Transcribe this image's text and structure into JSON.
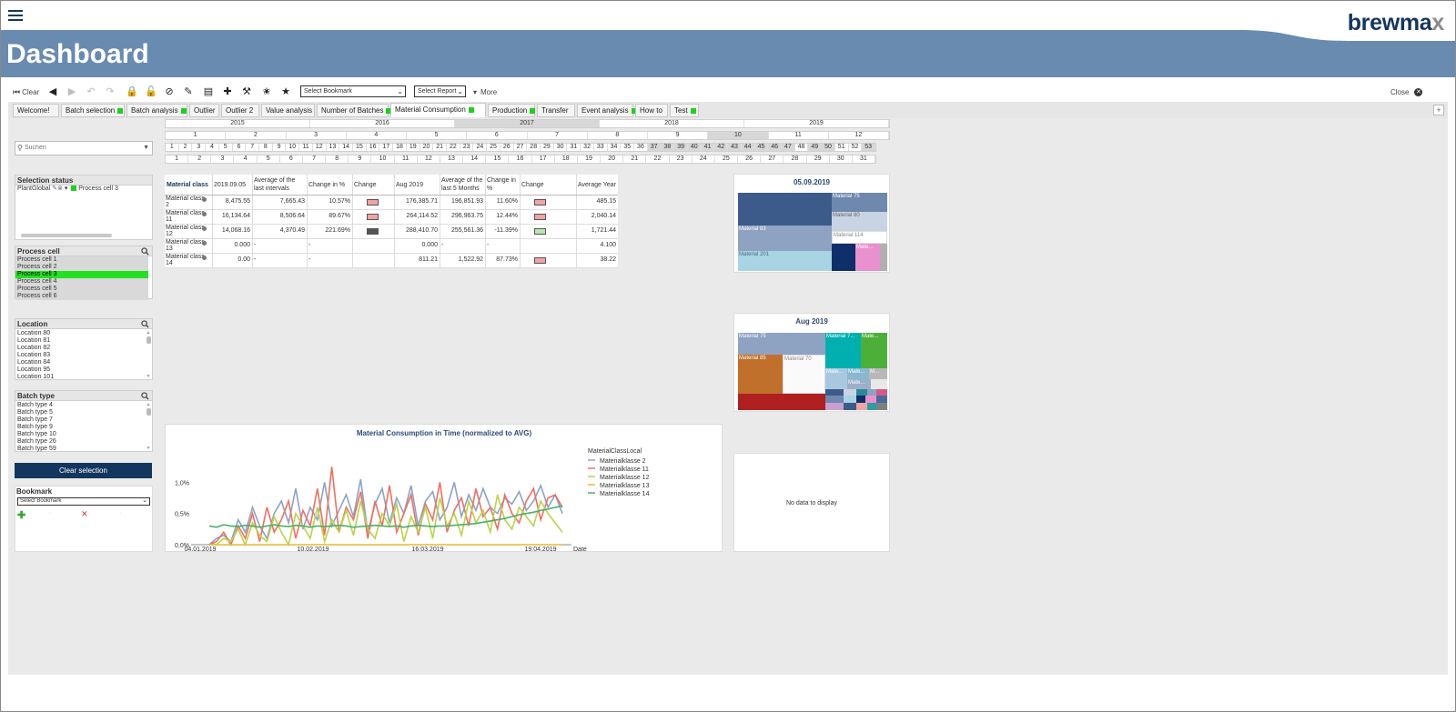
{
  "brand": {
    "name": "brewma",
    "x": "x"
  },
  "page_title": "Dashboard",
  "toolbar": {
    "clear": "Clear",
    "bookmark_select": "Select Bookmark",
    "report_select": "Select Report",
    "more": "More",
    "close": "Close"
  },
  "tabs": [
    {
      "label": "Welcome!",
      "dot": false
    },
    {
      "label": "Batch selection",
      "dot": true
    },
    {
      "label": "Batch analysis",
      "dot": true
    },
    {
      "label": "Outlier",
      "dot": false
    },
    {
      "label": "Outlier 2",
      "dot": false
    },
    {
      "label": "Value analysis",
      "dot": false
    },
    {
      "label": "Number of Batches",
      "dot": true
    },
    {
      "label": "Material Consumption",
      "dot": true
    },
    {
      "label": "Production",
      "dot": true
    },
    {
      "label": "Transfer",
      "dot": false
    },
    {
      "label": "Event analysis",
      "dot": true
    },
    {
      "label": "How to",
      "dot": false
    },
    {
      "label": "Test",
      "dot": true
    }
  ],
  "years": [
    "2015",
    "2016",
    "2017",
    "2018",
    "2019"
  ],
  "months": [
    "1",
    "2",
    "3",
    "4",
    "5",
    "6",
    "7",
    "8",
    "9",
    "10",
    "11",
    "12"
  ],
  "weeks": [
    "1",
    "2",
    "3",
    "4",
    "5",
    "6",
    "7",
    "8",
    "9",
    "10",
    "11",
    "12",
    "13",
    "14",
    "15",
    "16",
    "17",
    "18",
    "19",
    "20",
    "21",
    "22",
    "23",
    "24",
    "25",
    "26",
    "27",
    "28",
    "29",
    "30",
    "31",
    "32",
    "33",
    "34",
    "35",
    "36",
    "37",
    "38",
    "39",
    "40",
    "41",
    "42",
    "43",
    "44",
    "45",
    "46",
    "47",
    "48",
    "49",
    "50",
    "51",
    "52",
    "53"
  ],
  "days": [
    "1",
    "2",
    "3",
    "4",
    "5",
    "6",
    "7",
    "8",
    "9",
    "10",
    "11",
    "12",
    "13",
    "14",
    "15",
    "16",
    "17",
    "18",
    "19",
    "20",
    "21",
    "22",
    "23",
    "24",
    "25",
    "26",
    "27",
    "28",
    "29",
    "30",
    "31"
  ],
  "search": {
    "placeholder": "Suchen"
  },
  "selection_status": {
    "title": "Selection status",
    "field": "PlantGlobal",
    "value": "Process cell 3"
  },
  "process_cell": {
    "title": "Process cell",
    "items": [
      "Process cell 1",
      "Process cell 2",
      "Process cell 3",
      "Process cell 4",
      "Process cell 5",
      "Process cell 6"
    ],
    "selected": 2
  },
  "location": {
    "title": "Location",
    "items": [
      "Location 80",
      "Location 81",
      "Location 82",
      "Location 83",
      "Location 84",
      "Location 95",
      "Location 101"
    ]
  },
  "batch_type": {
    "title": "Batch type",
    "items": [
      "Batch type 4",
      "Batch type 5",
      "Batch type 7",
      "Batch type 9",
      "Batch type 10",
      "Batch type 26",
      "Batch type 59"
    ]
  },
  "clear_selection": "Clear selection",
  "bookmark": {
    "title": "Bookmark",
    "select": "Select Bookmark"
  },
  "table": {
    "headers": [
      "Material class",
      "2019.09.05",
      "Average of the last intervals",
      "Change in %",
      "Change",
      "Aug 2019",
      "Average of the last 5 Months",
      "Change in %",
      "Change",
      "Average Year"
    ],
    "rows": [
      {
        "label": "Material class 2",
        "v1": "8,475.55",
        "avg1": "7,665.43",
        "pct1": "10.57%",
        "c1": "#f2a3a3",
        "v2": "176,385.71",
        "avg2": "196,851.93",
        "pct2": "11.60%",
        "c2": "#f2a3a3",
        "year": "485.15"
      },
      {
        "label": "Material class 11",
        "v1": "16,134.64",
        "avg1": "8,506.64",
        "pct1": "89.67%",
        "c1": "#f2a3a3",
        "v2": "264,114.52",
        "avg2": "296,963.75",
        "pct2": "12.44%",
        "c2": "#f2a3a3",
        "year": "2,040.14"
      },
      {
        "label": "Material class 12",
        "v1": "14,068.16",
        "avg1": "4,370.49",
        "pct1": "221.69%",
        "c1": "#555555",
        "v2": "288,410.70",
        "avg2": "255,561.36",
        "pct2": "-11.39%",
        "c2": "#b8e6b0",
        "year": "1,721.44"
      },
      {
        "label": "Material class 13",
        "v1": "0.000",
        "avg1": "-",
        "pct1": "-",
        "c1": "",
        "v2": "0.000",
        "avg2": "-",
        "pct2": "-",
        "c2": "",
        "year": "4.100"
      },
      {
        "label": "Material class 14",
        "v1": "0.00",
        "avg1": "-",
        "pct1": "-",
        "c1": "",
        "v2": "811.21",
        "avg2": "1,522.92",
        "pct2": "87.73%",
        "c2": "#f2a3a3",
        "year": "38.22"
      }
    ]
  },
  "treemap1": {
    "title": "05.09.2019",
    "labels": [
      "Material 75",
      "Material 80",
      "Material 83",
      "Material 114",
      "Material 201",
      "Mate..."
    ]
  },
  "treemap2": {
    "title": "Aug 2019",
    "labels": [
      "Material 75",
      "Material 7...",
      "Mate...",
      "Material 85",
      "Material 70",
      "Mate...",
      "Mate...",
      "M...",
      "Mate..."
    ]
  },
  "no_data": "No data to display",
  "chart_data": {
    "type": "line",
    "title": "Material Consumption in Time (normalized to AVG)",
    "xlabel": "Date",
    "ylabel": "",
    "legend_title": "MaterialClassLocal",
    "legend_position": "right",
    "xticks": [
      "04.01.2019",
      "10.02.2019",
      "16.03.2019",
      "19.04.2019"
    ],
    "yticks": [
      "0,0%",
      "0,5%",
      "1,0%"
    ],
    "ylim": [
      0,
      1.4
    ],
    "series": [
      {
        "name": "Materialklasse 2",
        "color": "#8aa4c8",
        "values": [
          0.0,
          0.1,
          0.15,
          0.05,
          0.4,
          0.2,
          0.6,
          0.3,
          0.1,
          0.5,
          0.7,
          0.35,
          0.9,
          0.25,
          0.6,
          0.4,
          1.0,
          0.3,
          0.55,
          0.8,
          0.45,
          1.05,
          0.2,
          0.65,
          0.9,
          0.35,
          0.75,
          0.5,
          0.95,
          0.3,
          0.7,
          0.85,
          0.4,
          0.6,
          1.0,
          0.45,
          0.8,
          0.55,
          0.9,
          0.6,
          0.5,
          0.75,
          0.65,
          0.85,
          0.55,
          0.7,
          0.95,
          0.6,
          0.8,
          0.5
        ]
      },
      {
        "name": "Materialklasse 11",
        "color": "#f07060",
        "values": [
          0.0,
          0.05,
          0.2,
          0.0,
          0.3,
          0.1,
          0.5,
          0.05,
          0.6,
          0.2,
          0.4,
          0.7,
          0.1,
          0.55,
          0.3,
          0.9,
          0.15,
          1.25,
          0.2,
          0.6,
          0.4,
          0.85,
          0.1,
          0.7,
          0.3,
          0.95,
          0.2,
          0.5,
          0.8,
          0.15,
          0.65,
          0.4,
          1.0,
          0.2,
          0.55,
          0.75,
          0.3,
          0.9,
          0.45,
          0.6,
          0.25,
          0.8,
          0.5,
          0.35,
          0.7,
          0.9,
          0.4,
          0.75,
          0.8,
          0.6
        ]
      },
      {
        "name": "Materialklasse 12",
        "color": "#b8d44a",
        "values": [
          0.0,
          0.0,
          0.1,
          0.05,
          0.25,
          0.0,
          0.35,
          0.15,
          0.05,
          0.45,
          0.2,
          0.0,
          0.5,
          0.3,
          0.1,
          0.6,
          0.05,
          0.4,
          0.2,
          0.55,
          0.15,
          0.7,
          0.25,
          0.1,
          0.5,
          0.3,
          0.65,
          0.05,
          0.45,
          0.2,
          0.6,
          0.1,
          0.75,
          0.3,
          0.5,
          0.15,
          0.7,
          0.35,
          0.55,
          0.2,
          0.8,
          0.4,
          0.25,
          0.6,
          0.45,
          0.3,
          0.7,
          0.5,
          0.35,
          0.2
        ]
      },
      {
        "name": "Materialklasse 13",
        "color": "#e8b830",
        "values": [
          0.0,
          0.0,
          0.0,
          0.0,
          0.0,
          0.0,
          0.0,
          0.0,
          0.0,
          0.0,
          0.0,
          0.0,
          0.0,
          0.0,
          0.0,
          0.0,
          0.0,
          0.0,
          0.0,
          0.0,
          0.0,
          0.0,
          0.0,
          0.0,
          0.0,
          0.0,
          0.0,
          0.0,
          0.0,
          0.0,
          0.0,
          0.0,
          0.0,
          0.0,
          0.0,
          0.0,
          0.0,
          0.0,
          0.0,
          0.0,
          0.0,
          0.0,
          0.0,
          0.0,
          0.0,
          0.0,
          0.0,
          0.0,
          0.0,
          0.0
        ]
      },
      {
        "name": "Materialklasse 14",
        "color": "#4caf6a",
        "values": [
          0.3,
          0.28,
          0.32,
          0.3,
          0.29,
          0.31,
          0.3,
          0.28,
          0.3,
          0.32,
          0.3,
          0.29,
          0.31,
          0.3,
          0.28,
          0.3,
          0.29,
          0.3,
          0.31,
          0.3,
          0.28,
          0.29,
          0.3,
          0.31,
          0.3,
          0.29,
          0.3,
          0.28,
          0.3,
          0.31,
          0.3,
          0.29,
          0.3,
          0.3,
          0.31,
          0.32,
          0.33,
          0.34,
          0.36,
          0.38,
          0.4,
          0.42,
          0.45,
          0.48,
          0.5,
          0.52,
          0.55,
          0.57,
          0.6,
          0.62
        ]
      }
    ]
  }
}
